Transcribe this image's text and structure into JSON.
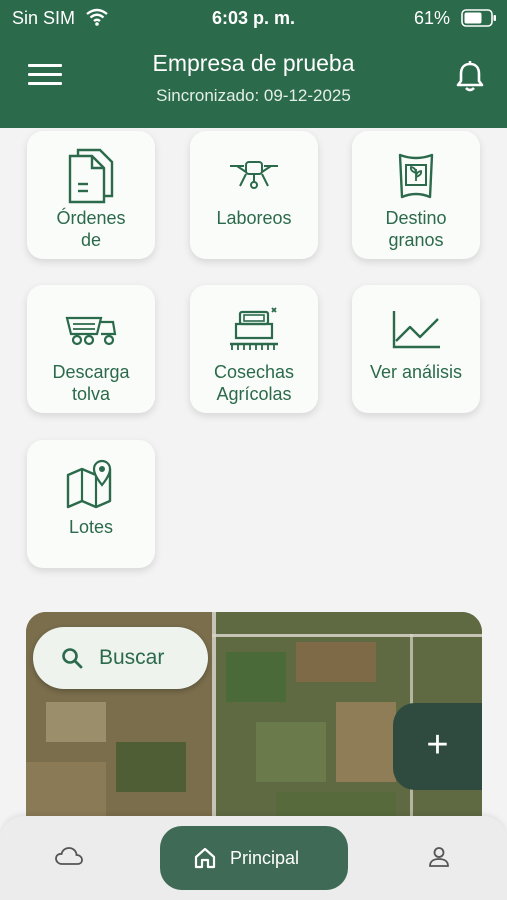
{
  "status_bar": {
    "carrier": "Sin SIM",
    "time": "6:03 p. m.",
    "battery": "61%"
  },
  "header": {
    "title": "Empresa de prueba",
    "subtitle": "Sincronizado: 09-12-2025"
  },
  "tiles": [
    {
      "label_1": "Órdenes",
      "label_2": "de",
      "icon": "documents-icon"
    },
    {
      "label_1": "Laboreos",
      "label_2": "",
      "icon": "drone-icon"
    },
    {
      "label_1": "Destino",
      "label_2": "granos",
      "icon": "grain-bag-icon"
    },
    {
      "label_1": "Descarga",
      "label_2": "tolva",
      "icon": "hopper-truck-icon"
    },
    {
      "label_1": "Cosechas",
      "label_2": "Agrícolas",
      "icon": "combine-harvester-icon"
    },
    {
      "label_1": "Ver análisis",
      "label_2": "",
      "icon": "line-chart-icon"
    },
    {
      "label_1": "Lotes",
      "label_2": "",
      "icon": "map-pin-icon"
    }
  ],
  "map": {
    "search_label": "Buscar",
    "fab_label": "+"
  },
  "bottom_nav": {
    "home_label": "Principal"
  },
  "colors": {
    "primary": "#2b6a4a",
    "tile_bg": "#fafcfa",
    "page_bg": "#f3f3f3",
    "fab": "#2f4a3f"
  }
}
